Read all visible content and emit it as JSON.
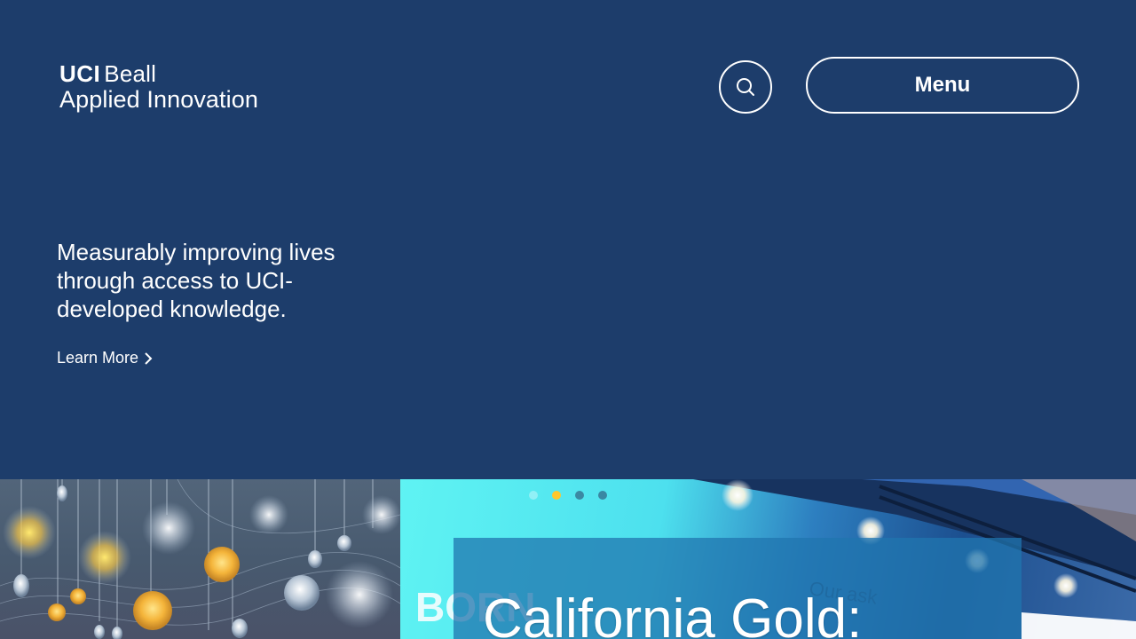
{
  "header": {
    "logo": {
      "line1_bold": "UCI",
      "line1_regular": "Beall",
      "line2": "Applied Innovation"
    },
    "search_icon": "search-icon",
    "menu_label": "Menu"
  },
  "hero": {
    "tagline": "Measurably improving lives through access to UCI-developed knowledge.",
    "learn_more_label": "Learn More",
    "learn_more_icon": "chevron-right-icon"
  },
  "carousel": {
    "slide_caption": "California Gold:",
    "dots_count": 4,
    "active_index": 1,
    "active_dot_color": "#ffc72c"
  },
  "colors": {
    "background": "#1d3d6b",
    "text": "#ffffff"
  }
}
